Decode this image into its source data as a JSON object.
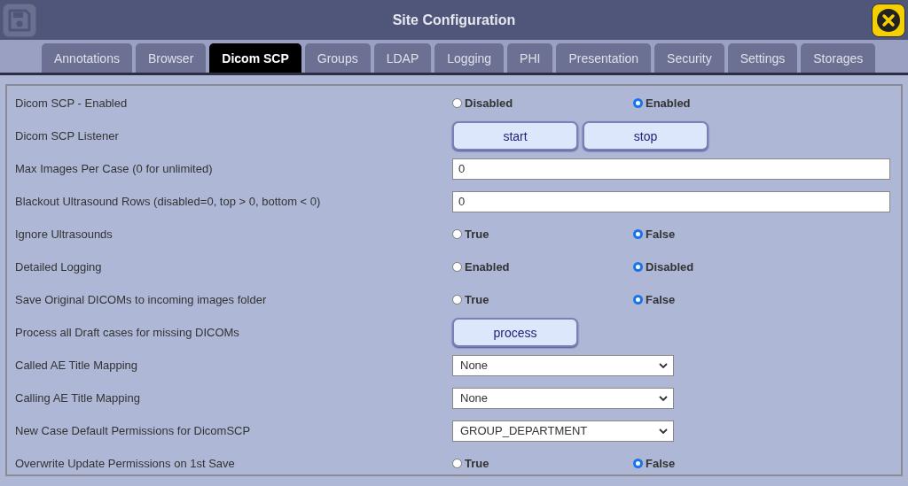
{
  "window": {
    "title": "Site Configuration"
  },
  "tabs": [
    {
      "label": "Annotations",
      "selected": false
    },
    {
      "label": "Browser",
      "selected": false
    },
    {
      "label": "Dicom SCP",
      "selected": true
    },
    {
      "label": "Groups",
      "selected": false
    },
    {
      "label": "LDAP",
      "selected": false
    },
    {
      "label": "Logging",
      "selected": false
    },
    {
      "label": "PHI",
      "selected": false
    },
    {
      "label": "Presentation",
      "selected": false
    },
    {
      "label": "Security",
      "selected": false
    },
    {
      "label": "Settings",
      "selected": false
    },
    {
      "label": "Storages",
      "selected": false
    }
  ],
  "settings": [
    {
      "label": "Dicom SCP - Enabled",
      "kind": "radio",
      "options": [
        {
          "label": "Disabled",
          "selected": false
        },
        {
          "label": "Enabled",
          "selected": true
        }
      ]
    },
    {
      "label": "Dicom SCP Listener",
      "kind": "buttons",
      "buttons": [
        "start",
        "stop"
      ]
    },
    {
      "label": "Max Images Per Case (0 for unlimited)",
      "kind": "text",
      "value": "0"
    },
    {
      "label": "Blackout Ultrasound Rows (disabled=0, top > 0, bottom < 0)",
      "kind": "text",
      "value": "0"
    },
    {
      "label": "Ignore Ultrasounds",
      "kind": "radio",
      "options": [
        {
          "label": "True",
          "selected": false
        },
        {
          "label": "False",
          "selected": true
        }
      ]
    },
    {
      "label": "Detailed Logging",
      "kind": "radio",
      "options": [
        {
          "label": "Enabled",
          "selected": false
        },
        {
          "label": "Disabled",
          "selected": true
        }
      ]
    },
    {
      "label": "Save Original DICOMs to incoming images folder",
      "kind": "radio",
      "options": [
        {
          "label": "True",
          "selected": false
        },
        {
          "label": "False",
          "selected": true
        }
      ]
    },
    {
      "label": "Process all Draft cases for missing DICOMs",
      "kind": "buttons",
      "buttons": [
        "process"
      ]
    },
    {
      "label": "Called AE Title Mapping",
      "kind": "select",
      "value": "None"
    },
    {
      "label": "Calling AE Title Mapping",
      "kind": "select",
      "value": "None"
    },
    {
      "label": "New Case Default Permissions for DicomSCP",
      "kind": "select",
      "value": "GROUP_DEPARTMENT"
    },
    {
      "label": "Overwrite Update Permissions on 1st Save",
      "kind": "radio",
      "options": [
        {
          "label": "True",
          "selected": false
        },
        {
          "label": "False",
          "selected": true
        }
      ]
    }
  ]
}
